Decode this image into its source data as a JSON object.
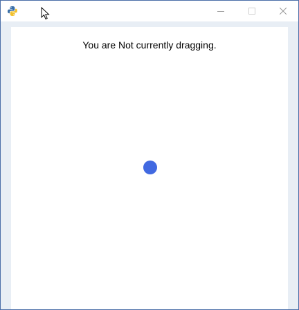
{
  "window": {
    "app_icon": "python-icon",
    "cursor_icon": "arrow-cursor-icon",
    "minimize_icon": "minimize-icon",
    "maximize_icon": "maximize-icon",
    "close_icon": "close-icon"
  },
  "canvas": {
    "status_text": "You are Not currently dragging.",
    "draggable_dot": {
      "color": "#4169e1"
    }
  },
  "colors": {
    "window_border": "#4a6ea8",
    "client_background": "#e8eef5",
    "canvas_background": "#ffffff",
    "dot": "#4169e1"
  }
}
